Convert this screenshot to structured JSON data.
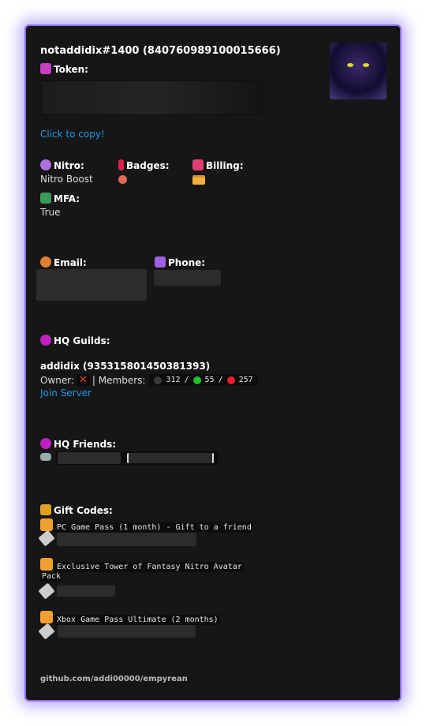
{
  "user": {
    "title": "notaddidix#1400 (840760989100015666)"
  },
  "token": {
    "label": "Token:",
    "copy_link": "Click to copy!"
  },
  "nitro": {
    "label": "Nitro:",
    "value": "Nitro Boost"
  },
  "badges": {
    "label": "Badges:"
  },
  "billing": {
    "label": "Billing:"
  },
  "mfa": {
    "label": "MFA:",
    "value": "True"
  },
  "email": {
    "label": "Email:"
  },
  "phone": {
    "label": "Phone:"
  },
  "guilds": {
    "label": "HQ Guilds:",
    "items": [
      {
        "name": "addidix (935315801450381393)",
        "owner_label": "Owner:",
        "owner_value": "✕",
        "members_label": "| Members:",
        "total": "312",
        "online": "55",
        "offline": "257",
        "sep": "/",
        "join": "Join Server"
      }
    ]
  },
  "friends": {
    "label": "HQ Friends:"
  },
  "gifts": {
    "label": "Gift Codes:",
    "items": [
      {
        "name": "PC Game Pass (1 month) - Gift to a friend"
      },
      {
        "name": "Exclusive Tower of Fantasy Nitro Avatar",
        "name2": "Pack"
      },
      {
        "name": "Xbox Game Pass Ultimate (2 months)"
      }
    ]
  },
  "footer": {
    "text": "github.com/addi00000/empyrean"
  },
  "colors": {
    "accent": "#8b6cf0",
    "link": "#1e9be8",
    "online": "#22c32a",
    "dnd": "#e8202a",
    "offline": "#3a3a3a"
  }
}
